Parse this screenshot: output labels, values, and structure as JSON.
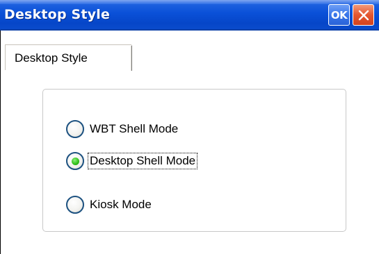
{
  "window": {
    "title": "Desktop Style",
    "ok_label": "OK"
  },
  "tabs": [
    {
      "label": "Desktop Style",
      "selected": true
    }
  ],
  "shell_mode": {
    "options": [
      {
        "label": "WBT Shell Mode",
        "checked": false
      },
      {
        "label": "Desktop Shell Mode",
        "checked": true
      },
      {
        "label": "Kiosk Mode",
        "checked": false
      }
    ],
    "selected": "Desktop Shell Mode"
  },
  "icons": {
    "close": "close-icon",
    "radio_selected_color": "#33c21c"
  },
  "colors": {
    "titlebar": "#0a50d8",
    "close_button": "#e4562f",
    "radio_border": "#1c5180"
  }
}
